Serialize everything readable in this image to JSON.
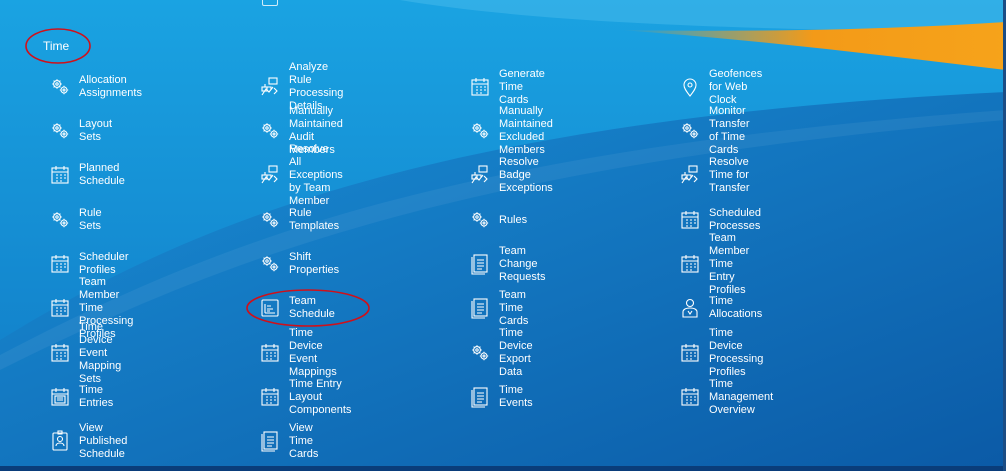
{
  "section": {
    "title": "Time"
  },
  "colors": {
    "bg_top": "#1a9ee0",
    "bg_bottom": "#0d62ae",
    "accent_orange": "#f6a21b",
    "annotation_red": "#d0101a"
  },
  "tiles": [
    {
      "label": "Allocation Assignments",
      "icon": "gears"
    },
    {
      "label": "Analyze Rule Processing Details",
      "icon": "flow"
    },
    {
      "label": "Generate Time Cards",
      "icon": "calendar"
    },
    {
      "label": "Geofences for Web Clock",
      "icon": "pin"
    },
    {
      "label": "Layout Sets",
      "icon": "gears"
    },
    {
      "label": "Manually Maintained Audit Members",
      "icon": "gears"
    },
    {
      "label": "Manually Maintained Excluded Members",
      "icon": "gears"
    },
    {
      "label": "Monitor Transfer of Time Cards",
      "icon": "gears"
    },
    {
      "label": "Planned Schedule",
      "icon": "calendar"
    },
    {
      "label": "Resolve All Exceptions by Team Member",
      "icon": "flow"
    },
    {
      "label": "Resolve Badge Exceptions",
      "icon": "flow"
    },
    {
      "label": "Resolve Time for Transfer",
      "icon": "flow"
    },
    {
      "label": "Rule Sets",
      "icon": "gears"
    },
    {
      "label": "Rule Templates",
      "icon": "gears"
    },
    {
      "label": "Rules",
      "icon": "gears"
    },
    {
      "label": "Scheduled Processes",
      "icon": "calendar"
    },
    {
      "label": "Scheduler Profiles",
      "icon": "calendar"
    },
    {
      "label": "Shift Properties",
      "icon": "gears"
    },
    {
      "label": "Team Change Requests",
      "icon": "doc"
    },
    {
      "label": "Team Member Time Entry Profiles",
      "icon": "calendar"
    },
    {
      "label": "Team Member Time Processing Profiles",
      "icon": "calendar"
    },
    {
      "label": "Team Schedule",
      "icon": "chart"
    },
    {
      "label": "Team Time Cards",
      "icon": "doc"
    },
    {
      "label": "Time Allocations",
      "icon": "person"
    },
    {
      "label": "Time Device Event Mapping Sets",
      "icon": "calendar"
    },
    {
      "label": "Time Device Event Mappings",
      "icon": "calendar"
    },
    {
      "label": "Time Device Export Data",
      "icon": "gears"
    },
    {
      "label": "Time Device Processing Profiles",
      "icon": "calendar"
    },
    {
      "label": "Time Entries",
      "icon": "entries"
    },
    {
      "label": "Time Entry Layout Components",
      "icon": "calendar"
    },
    {
      "label": "Time Events",
      "icon": "doc"
    },
    {
      "label": "Time Management Overview",
      "icon": "calendar"
    },
    {
      "label": "View Published Schedule",
      "icon": "badge"
    },
    {
      "label": "View Time Cards",
      "icon": "doc"
    }
  ]
}
